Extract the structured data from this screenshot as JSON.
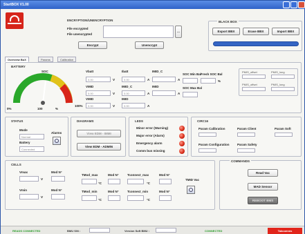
{
  "window": {
    "title": "StartBOX V1.00"
  },
  "encryption": {
    "title": "ENCRYPTION/UNENCRYPTION",
    "file_encrypted_label": "File encrypted",
    "file_unencrypted_label": "File unencrypted",
    "browse_label": "...",
    "encrypt_label": "Encrypt",
    "unencrypt_label": "Unencrypt"
  },
  "blackbox": {
    "title": "BLACK BOX",
    "export_label": "Export BBX",
    "erase_label": "Erase BBX",
    "import_label": "Import BBX"
  },
  "tabs": [
    "Overview BoX",
    "Params",
    "Calibration"
  ],
  "battery": {
    "title": "BATTERY",
    "gauge_label": "SOC",
    "gauge_min": "0%",
    "gauge_max": "100%",
    "gauge_value": "100",
    "gauge_unit": "%",
    "voltages": [
      {
        "label": "Vbatt",
        "value": "0.00",
        "unit": "V"
      },
      {
        "label": "VMID",
        "value": "0.00",
        "unit": "V"
      },
      {
        "label": "VMID",
        "value": "0.00",
        "unit": "V"
      }
    ],
    "currents": [
      {
        "label": "Ibatt",
        "value": "0.00",
        "unit": "A"
      },
      {
        "label": "IMID_C",
        "value": "0.00",
        "unit": "A"
      },
      {
        "label": "IMID",
        "value": "0.00",
        "unit": "A"
      }
    ],
    "currents2": [
      {
        "label": "IMID_C",
        "value": "0.00",
        "unit": "A"
      },
      {
        "label": "IMID",
        "value": "0.00",
        "unit": "A"
      }
    ],
    "soc_min_bal": "SOC Min Bal",
    "soc_max_bal": "SOC Max Bal",
    "fresh_soc_bal": "Fresh SOC Bal",
    "soc_unit": "%",
    "pmis_labels": [
      "PMIS_offset",
      "PMIS_long",
      "PMIS_offset",
      "PMIS_long"
    ]
  },
  "status": {
    "title": "STATUS",
    "mode_label": "Mode",
    "mode_value": "Normal",
    "alarms_label": "Alarms",
    "battery_label": "Battery",
    "battery_value": "Connected"
  },
  "diagrams": {
    "title": "DIAGRAMS",
    "view1_label": "View EDM - IMMI",
    "view2_label": "View EDM - ADMIN"
  },
  "leds": {
    "title": "LEDS",
    "items": [
      "Minor error (Warning)",
      "Major error (Alarm)",
      "Emergency alarm",
      "Comm bus missing"
    ]
  },
  "circ": {
    "title": "CIRC16",
    "labels": [
      "Param Calibration",
      "Param Client",
      "Param Soft",
      "Param Configuration",
      "Param Safety"
    ]
  },
  "cells": {
    "title": "CELLS",
    "vmax": "Vmax",
    "vmin": "Vmin",
    "cell_no": "Mod N°",
    "tmod_max": "TMod_max",
    "tmod_min": "TMod_min",
    "tconnect_max": "Tconnect_max",
    "tconnect_min": "Tconnect_min",
    "v_unit": "V",
    "t_unit": "°C",
    "tmid_label": "TMID Vac"
  },
  "commands": {
    "title": "COMMANDS",
    "read_label": "Read Vac",
    "mad_label": "MAD Sensor",
    "reboot_label": "REBOOT BMS"
  },
  "statusbar": {
    "left": "READS CONNECTED",
    "bmu_label": "BMU S/N :",
    "version_label": "Version Soft BMU :",
    "connected": "CONNECTED",
    "right": "Tabcomms"
  },
  "colors": {
    "accent_red": "#e1251b",
    "status_green": "#2a9d2a",
    "progress_blue": "#3566c4"
  }
}
